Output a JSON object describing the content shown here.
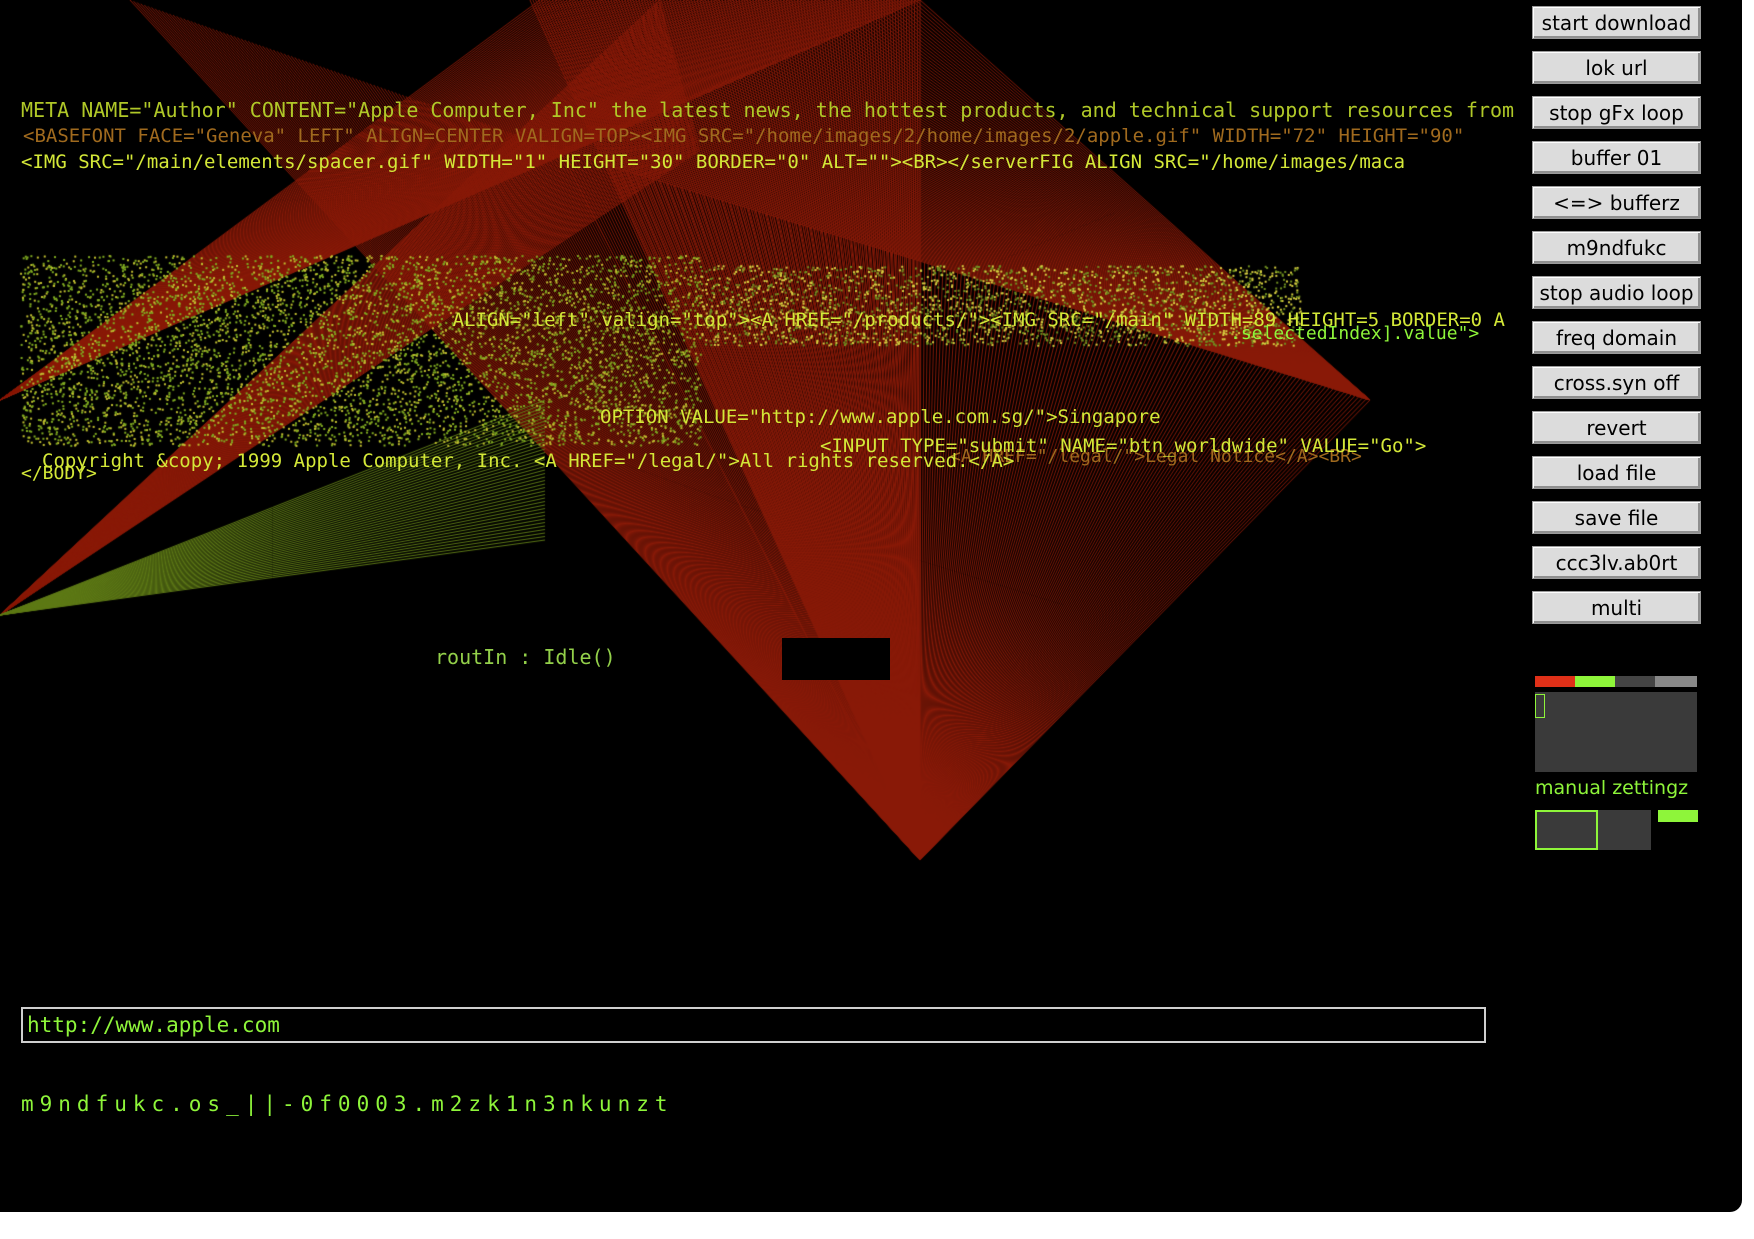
{
  "buttons": [
    {
      "label": "start download"
    },
    {
      "label": "lok url"
    },
    {
      "label": "stop gFx loop"
    },
    {
      "label": "buffer 01"
    },
    {
      "label": "<=> bufferz"
    },
    {
      "label": "m9ndfukc"
    },
    {
      "label": "stop audio loop"
    },
    {
      "label": "freq domain"
    },
    {
      "label": "cross.syn off"
    },
    {
      "label": "revert"
    },
    {
      "label": "load file"
    },
    {
      "label": "save file"
    },
    {
      "label": "ccc3lv.ab0rt"
    },
    {
      "label": "multi"
    }
  ],
  "code_lines": [
    "META NAME=\"Author\" CONTENT=\"Apple Computer, Inc\" the latest news, the hottest products, and technical support resources from",
    "<BASEFONT FACE=\"Geneva\" LEFT\" ALIGN=CENTER VALIGN=TOP><IMG SRC=\"/home/images/2/home/images/2/apple.gif\" WIDTH=\"72\" HEIGHT=\"90\"",
    "<IMG SRC=\"/main/elements/spacer.gif\" WIDTH=\"1\" HEIGHT=\"30\" BORDER=\"0\" ALT=\"\"><BR></serverFIG ALIGN SRC=\"/home/images/maca",
    "ALIGN=\"left\" valign=\"top\"><A HREF=\"/products/\"><IMG SRC=\"/main\" WIDTH=89 HEIGHT=5 BORDER=0 A",
    ".selectedIndex].value\">",
    "OPTION VALUE=\"http://www.apple.com.sg/\">Singapore",
    "<A HREF=\"/legal/\">Legal Notice</A><BR>",
    "<INPUT TYPE=\"submit\" NAME=\"btn_worldwide\" VALUE=\"Go\">",
    "Copyright &copy; 1999 Apple Computer, Inc. <A HREF=\"/legal/\">All rights reserved.</A>",
    "</BODY>"
  ],
  "status_text": "routIn : Idle()",
  "url_input": {
    "value": "http://www.apple.com"
  },
  "footer_text": "m9ndfukc.os_||-0f0003.m2zk1n3nkunzt",
  "manual_label": "manual zettingz",
  "colors": {
    "background": "#000000",
    "fan_red": "#8a1a08",
    "text_green": "#8ef53a",
    "meter_red": "#e03018",
    "meter_green": "#8ef53a",
    "panel_grey": "#3a3a3a"
  }
}
